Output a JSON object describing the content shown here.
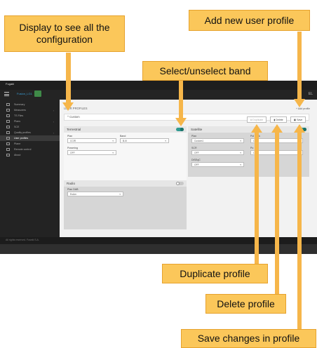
{
  "callouts": {
    "display_all": "Display to see all the configuration",
    "select_band": "Select/unselect band",
    "add_profile": "Add new user profile",
    "duplicate": "Duplicate profile",
    "delete": "Delete profile",
    "save": "Save changes in profile"
  },
  "app": {
    "topbar_title": "Fugakl",
    "device_name": "Fusion_LG1",
    "brand_right": "EL"
  },
  "sidebar": {
    "items": [
      {
        "label": "Summary"
      },
      {
        "label": "Measurers"
      },
      {
        "label": "TS Files"
      },
      {
        "label": "Plans"
      },
      {
        "label": "SCE"
      },
      {
        "label": "Quality profiles"
      },
      {
        "label": "User profiles"
      },
      {
        "label": "Plane"
      },
      {
        "label": "Remote control"
      },
      {
        "label": "About"
      }
    ]
  },
  "main": {
    "section_title": "USER PROFILES",
    "add_button": "+ Add profile",
    "profile_name": "Custom",
    "buttons": {
      "duplicate": "Duplicate",
      "delete": "Delete",
      "save": "Save"
    },
    "terrestrial": {
      "title": "Terrestrial",
      "plan_label": "Plan",
      "plan_value": "CCIR",
      "band_label": "Band",
      "band_value": "B-III",
      "powering_label": "Powering",
      "powering_value": "OFF"
    },
    "satellite": {
      "title": "Satellite",
      "plan_label": "Plan",
      "plan_value": "Custom1",
      "polarity_label": "Pol / 22k",
      "polarity_value": "Off",
      "lcr_label": "SCR",
      "lcr_value": "OFF",
      "diseqc_label": "DiSEqC",
      "diseqc_value": "OFF",
      "power_label": "Po",
      "power_value": "Off"
    },
    "radio": {
      "title": "Radio",
      "plan_label": "Plan DAB",
      "plan_value": "Eu&m"
    }
  },
  "footer": {
    "text": "All rights reserved. Fusekl S.A."
  }
}
